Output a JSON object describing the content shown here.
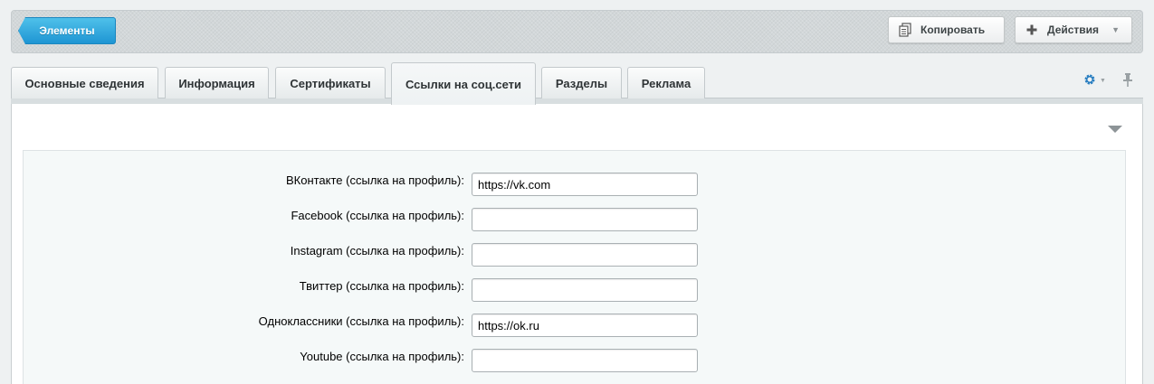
{
  "toolbar": {
    "back_label": "Элементы",
    "copy_label": "Копировать",
    "actions_label": "Действия"
  },
  "tabs": [
    {
      "label": "Основные сведения"
    },
    {
      "label": "Информация"
    },
    {
      "label": "Сертификаты"
    },
    {
      "label": "Ссылки на соц.сети",
      "active": true
    },
    {
      "label": "Разделы"
    },
    {
      "label": "Реклама"
    }
  ],
  "icons": {
    "settings": "gear-icon",
    "pin": "pin-icon",
    "collapse": "triangle-down-icon",
    "copy": "copy-icon",
    "add": "plus-icon"
  },
  "colors": {
    "accent": "#1e95d3",
    "settings_icon": "#2a7fc1"
  },
  "form": {
    "fields": [
      {
        "label": "ВКонтакте (ссылка на профиль):",
        "value": "https://vk.com"
      },
      {
        "label": "Facebook (ссылка на профиль):",
        "value": ""
      },
      {
        "label": "Instagram (ссылка на профиль):",
        "value": ""
      },
      {
        "label": "Твиттер (ссылка на профиль):",
        "value": ""
      },
      {
        "label": "Одноклассники (ссылка на профиль):",
        "value": "https://ok.ru"
      },
      {
        "label": "Youtube (ссылка на профиль):",
        "value": ""
      }
    ]
  }
}
